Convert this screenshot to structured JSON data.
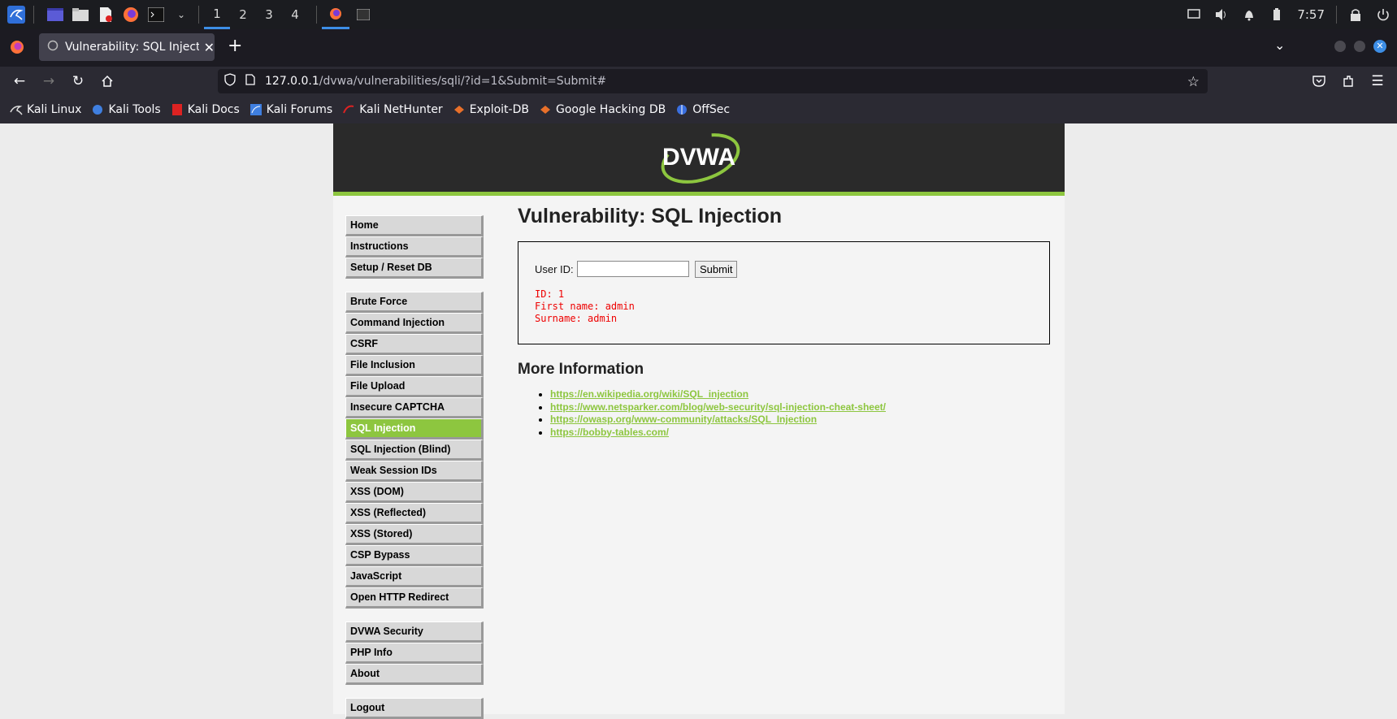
{
  "taskbar": {
    "workspaces": [
      "1",
      "2",
      "3",
      "4"
    ],
    "active_workspace": "1",
    "clock": "7:57"
  },
  "browser": {
    "tab_title": "Vulnerability: SQL Injectio",
    "url_host": "127.0.0.1",
    "url_path": "/dvwa/vulnerabilities/sqli/?id=1&Submit=Submit#",
    "bookmarks": [
      "Kali Linux",
      "Kali Tools",
      "Kali Docs",
      "Kali Forums",
      "Kali NetHunter",
      "Exploit-DB",
      "Google Hacking DB",
      "OffSec"
    ]
  },
  "dvwa": {
    "logo": "DVWA",
    "menu_group1": [
      "Home",
      "Instructions",
      "Setup / Reset DB"
    ],
    "menu_group2": [
      "Brute Force",
      "Command Injection",
      "CSRF",
      "File Inclusion",
      "File Upload",
      "Insecure CAPTCHA",
      "SQL Injection",
      "SQL Injection (Blind)",
      "Weak Session IDs",
      "XSS (DOM)",
      "XSS (Reflected)",
      "XSS (Stored)",
      "CSP Bypass",
      "JavaScript",
      "Open HTTP Redirect"
    ],
    "menu_group3": [
      "DVWA Security",
      "PHP Info",
      "About"
    ],
    "menu_group4": [
      "Logout"
    ],
    "selected_item": "SQL Injection",
    "page_title": "Vulnerability: SQL Injection",
    "form": {
      "label": "User ID:",
      "input_value": "",
      "submit_label": "Submit"
    },
    "result": {
      "line1": "ID: 1",
      "line2": "First name: admin",
      "line3": "Surname: admin"
    },
    "more_info_heading": "More Information",
    "links": [
      "https://en.wikipedia.org/wiki/SQL_injection",
      "https://www.netsparker.com/blog/web-security/sql-injection-cheat-sheet/",
      "https://owasp.org/www-community/attacks/SQL_Injection",
      "https://bobby-tables.com/"
    ]
  }
}
